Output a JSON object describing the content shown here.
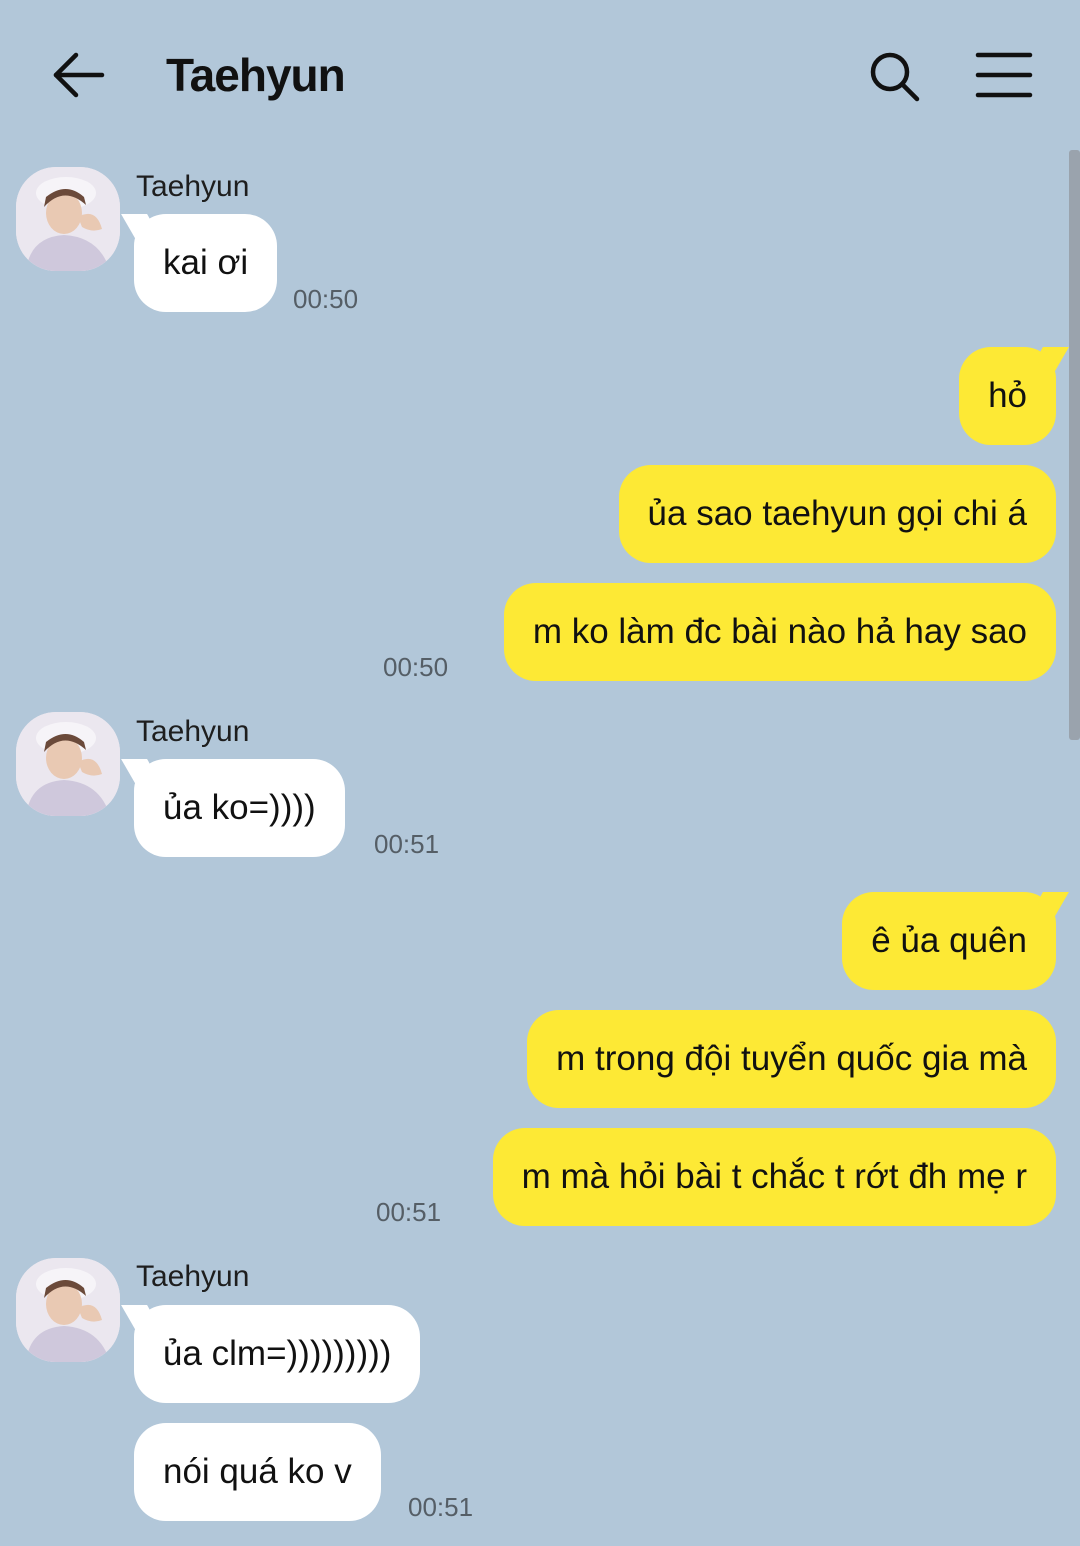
{
  "header": {
    "title": "Taehyun",
    "back_icon": "arrow-left-icon",
    "search_icon": "search-icon",
    "menu_icon": "hamburger-menu-icon"
  },
  "colors": {
    "background": "#b2c7d9",
    "incoming_bubble": "#ffffff",
    "outgoing_bubble": "#fde935"
  },
  "groups": [
    {
      "sender": "Taehyun",
      "messages": [
        "kai ơi"
      ],
      "time": "00:50"
    },
    {
      "messages": [
        "hỏ",
        "ủa sao taehyun gọi chi á",
        "m ko làm đc bài nào hả hay sao"
      ],
      "time": "00:50"
    },
    {
      "sender": "Taehyun",
      "messages": [
        "ủa ko=))))"
      ],
      "time": "00:51"
    },
    {
      "messages": [
        "ê ủa quên",
        "m trong đội tuyển quốc gia mà",
        "m mà hỏi bài t chắc t rớt đh mẹ r"
      ],
      "time": "00:51"
    },
    {
      "sender": "Taehyun",
      "messages": [
        "ủa clm=)))))))))",
        "nói quá ko v"
      ],
      "time": "00:51"
    }
  ]
}
